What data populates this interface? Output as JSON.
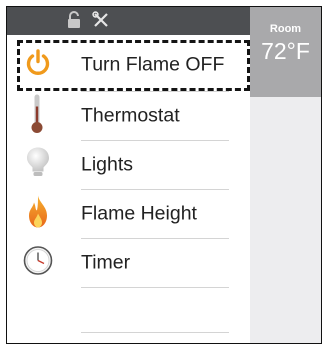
{
  "menu": {
    "items": [
      {
        "label": "Turn Flame OFF",
        "icon": "power-icon",
        "color": "#f09a1c"
      },
      {
        "label": "Thermostat",
        "icon": "thermometer-icon",
        "color": "#8b5a3c"
      },
      {
        "label": "Lights",
        "icon": "lightbulb-icon",
        "color": "#dcdcdc"
      },
      {
        "label": "Flame Height",
        "icon": "flame-icon",
        "color": "#f07b1a"
      },
      {
        "label": "Timer",
        "icon": "clock-icon",
        "color": "#555555"
      }
    ]
  },
  "topbar": {
    "icons": [
      "lock-icon",
      "wrench-screwdriver-icon"
    ]
  },
  "room": {
    "label": "Room",
    "temperature": "72°F"
  },
  "colors": {
    "accent": "#f09a1c",
    "topbar": "#4d4f52",
    "room_header": "#a9a9ab"
  }
}
